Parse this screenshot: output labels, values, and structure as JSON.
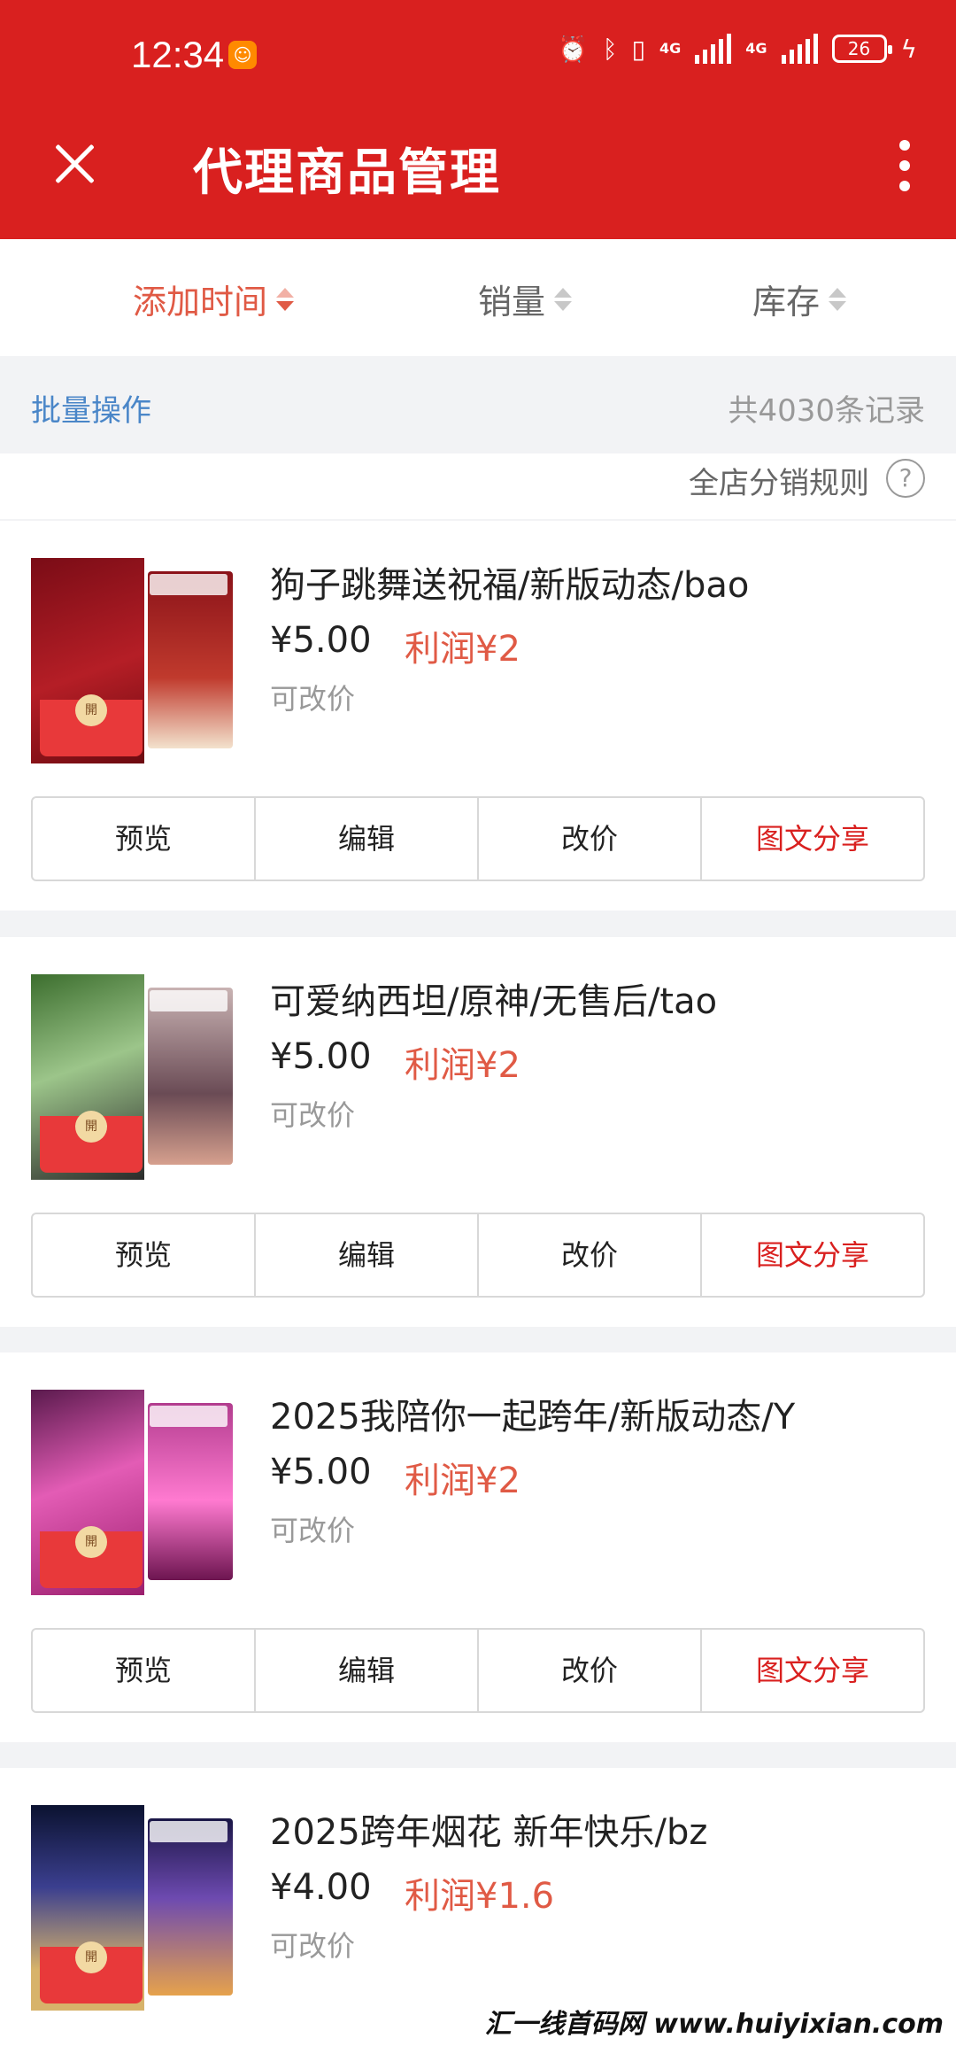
{
  "status_bar": {
    "time": "12:34",
    "net1": "4G",
    "net2": "4G",
    "battery": "26"
  },
  "header": {
    "title": "代理商品管理"
  },
  "sort": {
    "items": [
      {
        "label": "添加时间",
        "active": true
      },
      {
        "label": "销量",
        "active": false
      },
      {
        "label": "库存",
        "active": false
      }
    ]
  },
  "batch": {
    "label": "批量操作",
    "count": "共4030条记录"
  },
  "rules": {
    "label": "全店分销规则",
    "help": "?"
  },
  "products": [
    {
      "title": "狗子跳舞送祝福/新版动态/bao",
      "price": "¥5.00",
      "profit": "利润¥2",
      "note": "可改价",
      "seal": "開"
    },
    {
      "title": "可爱纳西坦/原神/无售后/tao",
      "price": "¥5.00",
      "profit": "利润¥2",
      "note": "可改价",
      "seal": "開"
    },
    {
      "title": "2025我陪你一起跨年/新版动态/Y",
      "price": "¥5.00",
      "profit": "利润¥2",
      "note": "可改价",
      "seal": "開"
    },
    {
      "title": "2025跨年烟花 新年快乐/bz",
      "price": "¥4.00",
      "profit": "利润¥1.6",
      "note": "可改价",
      "seal": "開"
    }
  ],
  "actions": {
    "preview": "预览",
    "edit": "编辑",
    "reprice": "改价",
    "share": "图文分享"
  },
  "watermark": "汇一线首码网 www.huiyixian.com",
  "colors": {
    "brand_red": "#d9201f",
    "profit": "#e05a45",
    "link_blue": "#4a86c8"
  }
}
